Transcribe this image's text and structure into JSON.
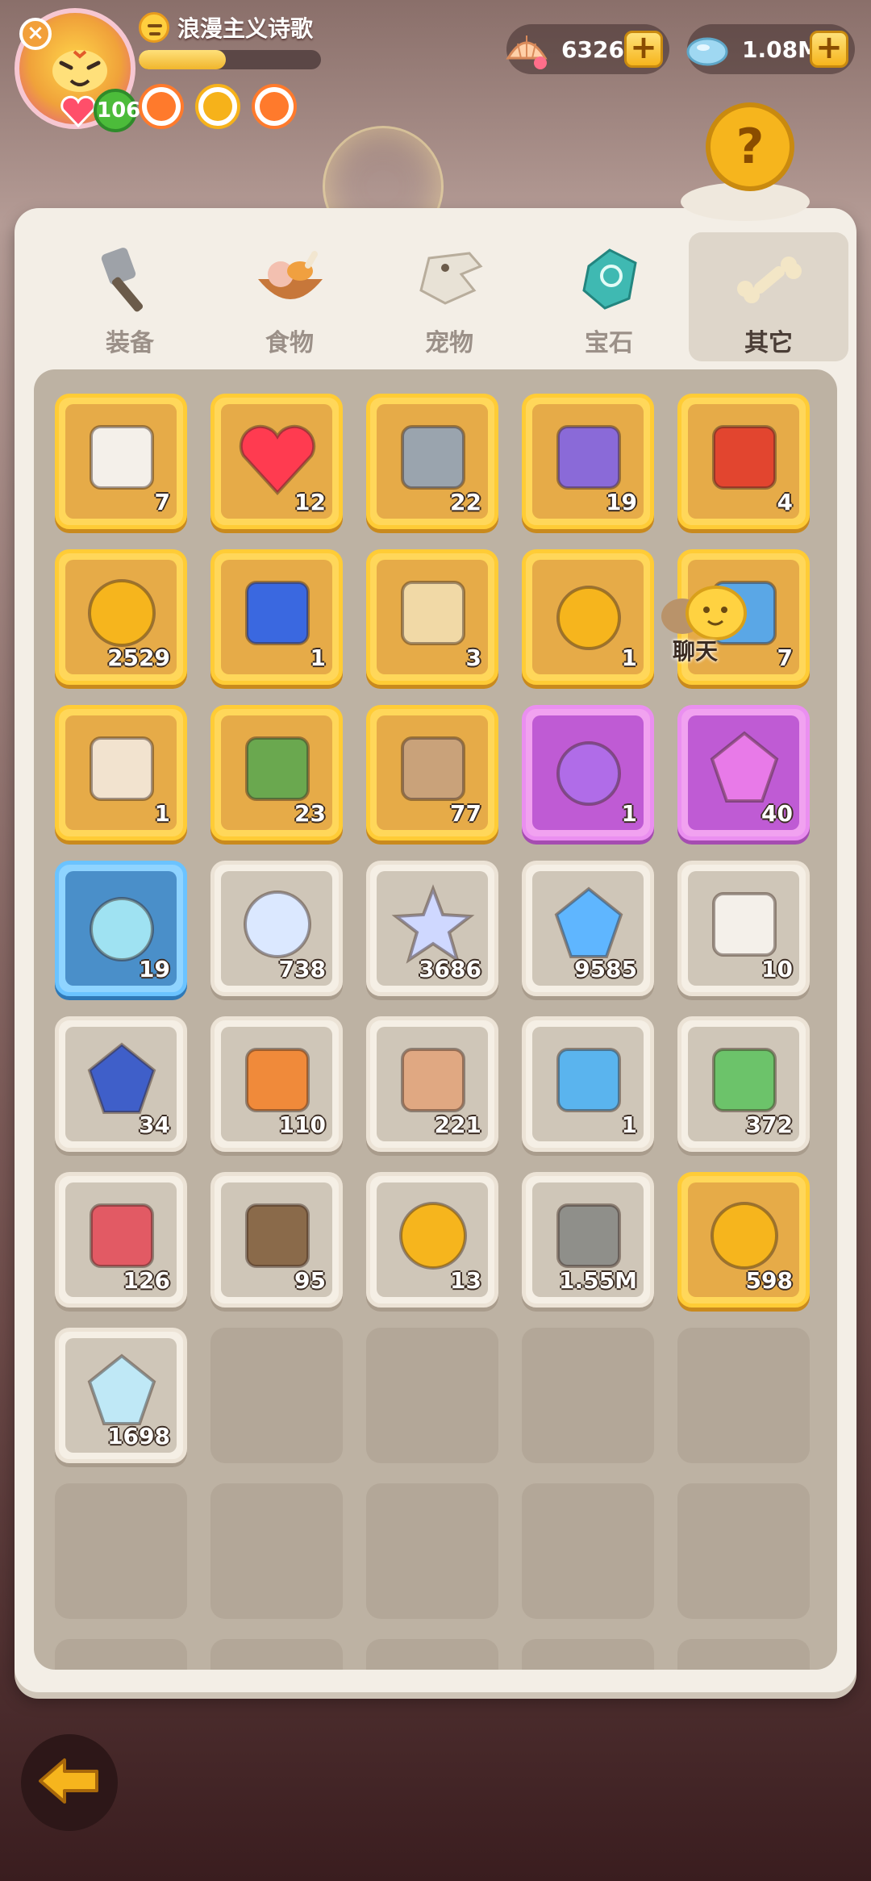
{
  "player": {
    "name": "浪漫主义诗歌",
    "level": "106",
    "xp_progress": 0.48,
    "buffs": [
      "fire-buff-icon",
      "gold-buff-icon",
      "shield-buff-icon"
    ]
  },
  "currencies": [
    {
      "name": "shell-icon",
      "value": "6326"
    },
    {
      "name": "crystal-icon",
      "value": "1.08M"
    }
  ],
  "tabs": [
    {
      "label": "装备",
      "icon": "equipment-icon",
      "active": false
    },
    {
      "label": "食物",
      "icon": "food-icon",
      "active": false
    },
    {
      "label": "宠物",
      "icon": "pet-icon",
      "active": false
    },
    {
      "label": "宝石",
      "icon": "gem-icon",
      "active": false
    },
    {
      "label": "其它",
      "icon": "bone-icon",
      "active": true
    }
  ],
  "chat": {
    "label": "聊天"
  },
  "colors": {
    "gold": "#ffd75a",
    "purple": "#f1a2f0",
    "blue": "#8fd4ff",
    "white": "#f5efe5",
    "empty": "#b3a798"
  },
  "inventory": [
    {
      "icon": "dice-icon",
      "rarity": "gold",
      "count": "7"
    },
    {
      "icon": "heart-icon",
      "rarity": "gold",
      "count": "12"
    },
    {
      "icon": "magnifier-icon",
      "rarity": "gold",
      "count": "22"
    },
    {
      "icon": "loot-bag-icon",
      "rarity": "gold",
      "count": "19"
    },
    {
      "icon": "treasure-chest-icon",
      "rarity": "gold",
      "count": "4"
    },
    {
      "icon": "gold-coin-icon",
      "rarity": "gold",
      "count": "2529"
    },
    {
      "icon": "winged-badge-icon",
      "rarity": "gold",
      "count": "1"
    },
    {
      "icon": "map-scroll-icon",
      "rarity": "gold",
      "count": "3"
    },
    {
      "icon": "golden-egg-icon",
      "rarity": "gold",
      "count": "1"
    },
    {
      "icon": "blue-card-icon",
      "rarity": "gold",
      "count": "7"
    },
    {
      "icon": "caveman-portrait-icon",
      "rarity": "gold",
      "count": "1"
    },
    {
      "icon": "green-totem-icon",
      "rarity": "gold",
      "count": "23"
    },
    {
      "icon": "stone-totem-icon",
      "rarity": "gold",
      "count": "77"
    },
    {
      "icon": "purple-potion-icon",
      "rarity": "purple",
      "count": "1"
    },
    {
      "icon": "pink-crystal-icon",
      "rarity": "purple",
      "count": "40"
    },
    {
      "icon": "blue-potion-icon",
      "rarity": "blue",
      "count": "19"
    },
    {
      "icon": "moon-icon",
      "rarity": "white",
      "count": "738"
    },
    {
      "icon": "star-icon",
      "rarity": "white",
      "count": "3686"
    },
    {
      "icon": "blue-gem-icon",
      "rarity": "white",
      "count": "9585"
    },
    {
      "icon": "dice-icon",
      "rarity": "white",
      "count": "10"
    },
    {
      "icon": "rune-stone-icon",
      "rarity": "white",
      "count": "34"
    },
    {
      "icon": "orange-scroll-icon",
      "rarity": "white",
      "count": "110"
    },
    {
      "icon": "paw-scroll-icon",
      "rarity": "white",
      "count": "221"
    },
    {
      "icon": "pencil-card-icon",
      "rarity": "white",
      "count": "1"
    },
    {
      "icon": "green-ticket-icon",
      "rarity": "white",
      "count": "372"
    },
    {
      "icon": "red-ticket-icon",
      "rarity": "white",
      "count": "126"
    },
    {
      "icon": "play-scroll-icon",
      "rarity": "white",
      "count": "95"
    },
    {
      "icon": "shell-coin-icon",
      "rarity": "white",
      "count": "13"
    },
    {
      "icon": "swirl-stone-icon",
      "rarity": "white",
      "count": "1.55M"
    },
    {
      "icon": "gold-rune-coin-icon",
      "rarity": "gold",
      "count": "598"
    },
    {
      "icon": "rainbow-crystal-icon",
      "rarity": "white",
      "count": "1698"
    },
    {
      "icon": "",
      "rarity": "empty",
      "count": ""
    },
    {
      "icon": "",
      "rarity": "empty",
      "count": ""
    },
    {
      "icon": "",
      "rarity": "empty",
      "count": ""
    },
    {
      "icon": "",
      "rarity": "empty",
      "count": ""
    },
    {
      "icon": "",
      "rarity": "empty",
      "count": ""
    },
    {
      "icon": "",
      "rarity": "empty",
      "count": ""
    },
    {
      "icon": "",
      "rarity": "empty",
      "count": ""
    },
    {
      "icon": "",
      "rarity": "empty",
      "count": ""
    },
    {
      "icon": "",
      "rarity": "empty",
      "count": ""
    },
    {
      "icon": "",
      "rarity": "empty",
      "count": ""
    },
    {
      "icon": "",
      "rarity": "empty",
      "count": ""
    },
    {
      "icon": "",
      "rarity": "empty",
      "count": ""
    },
    {
      "icon": "",
      "rarity": "empty",
      "count": ""
    },
    {
      "icon": "",
      "rarity": "empty",
      "count": ""
    }
  ]
}
